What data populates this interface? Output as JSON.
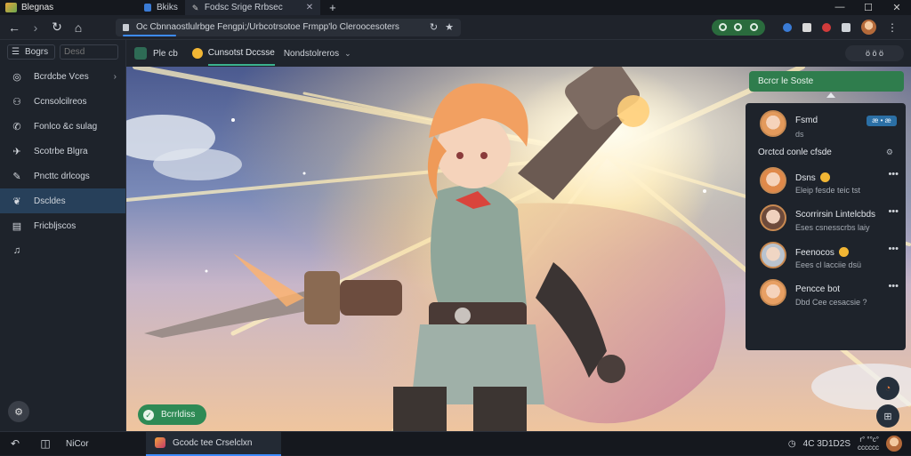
{
  "titlebar": {
    "app_name": "Blegnas",
    "tabs": [
      {
        "label": "Bkiks",
        "active": false
      },
      {
        "label": "Fodsc Srige Rrbsec",
        "active": true
      }
    ],
    "close_tab_icon": "close-icon",
    "new_tab_icon": "plus-icon",
    "window_controls": [
      "minimize-icon",
      "maximize-icon",
      "close-icon"
    ]
  },
  "navbar": {
    "url": "Oc Cbnnaostlulrbge Fengpi;/Urbcotrsotoe Frmpp'lo Cleroocesoters",
    "extension_group_icons": [
      "whatsapp-icon",
      "chat-icon",
      "discord-icon"
    ],
    "right_icons": [
      "shield-icon",
      "mail-icon",
      "record-icon",
      "grid-icon"
    ]
  },
  "sidebar": {
    "menu_label": "Bogrs",
    "search_placeholder": "Desd",
    "items": [
      {
        "label": "Bcrdcbe Vces",
        "icon": "globe-icon",
        "has_submenu": true,
        "active": false
      },
      {
        "label": "Ccnsolcilreos",
        "icon": "people-icon",
        "has_submenu": false,
        "active": false
      },
      {
        "label": "Fonlco &c sulag",
        "icon": "phone-icon",
        "has_submenu": false,
        "active": false
      },
      {
        "label": "Scotrbe Blgra",
        "icon": "pin-icon",
        "has_submenu": false,
        "active": false
      },
      {
        "label": "Pncttc drlcogs",
        "icon": "brush-icon",
        "has_submenu": false,
        "active": false
      },
      {
        "label": "Dscldes",
        "icon": "leaf-icon",
        "has_submenu": false,
        "active": true
      },
      {
        "label": "Fricbljscos",
        "icon": "document-icon",
        "has_submenu": false,
        "active": false
      },
      {
        "label": "",
        "icon": "bell-icon",
        "has_submenu": false,
        "active": false
      }
    ],
    "bottom_icon": "settings-icon"
  },
  "content_tabs": {
    "left_label": "Ple cb",
    "active_tab": "Cunsotst Dccsse",
    "second_tab": "Nondstolreros",
    "right_icons_label": "ö ö ö"
  },
  "promo_button": {
    "label": "Bcrrldiss"
  },
  "chat": {
    "header_button": "Bcrcr le Soste",
    "me": {
      "name": "Fsmd",
      "sub": "ds",
      "badge": "æ • æ"
    },
    "section_title": "Orctcd conle cfsde",
    "friends": [
      {
        "name": "Dsns",
        "message": "Eleip fesde teic tst",
        "emoji": true
      },
      {
        "name": "Scorrirsin Lintelcbds",
        "message": "Eses csnesscrbs laiy",
        "emoji": false
      },
      {
        "name": "Feenocos",
        "message": "Eees cl lacciie dsü",
        "emoji": true
      },
      {
        "name": "Pencce bot",
        "message": "Dbd Cee cesacsie ?",
        "emoji": false
      }
    ]
  },
  "statusbar": {
    "label": "NiCor",
    "task_label": "Gcodc tee Crselclxn",
    "time": "4C 3D1D2S",
    "date_top": "r° °°c°",
    "date_bottom": "cccccc"
  },
  "colors": {
    "accent_green": "#2f7d4d",
    "accent_blue": "#3d8bfd",
    "sidebar_active": "#27405a",
    "bg_dark": "#1b1f27"
  }
}
